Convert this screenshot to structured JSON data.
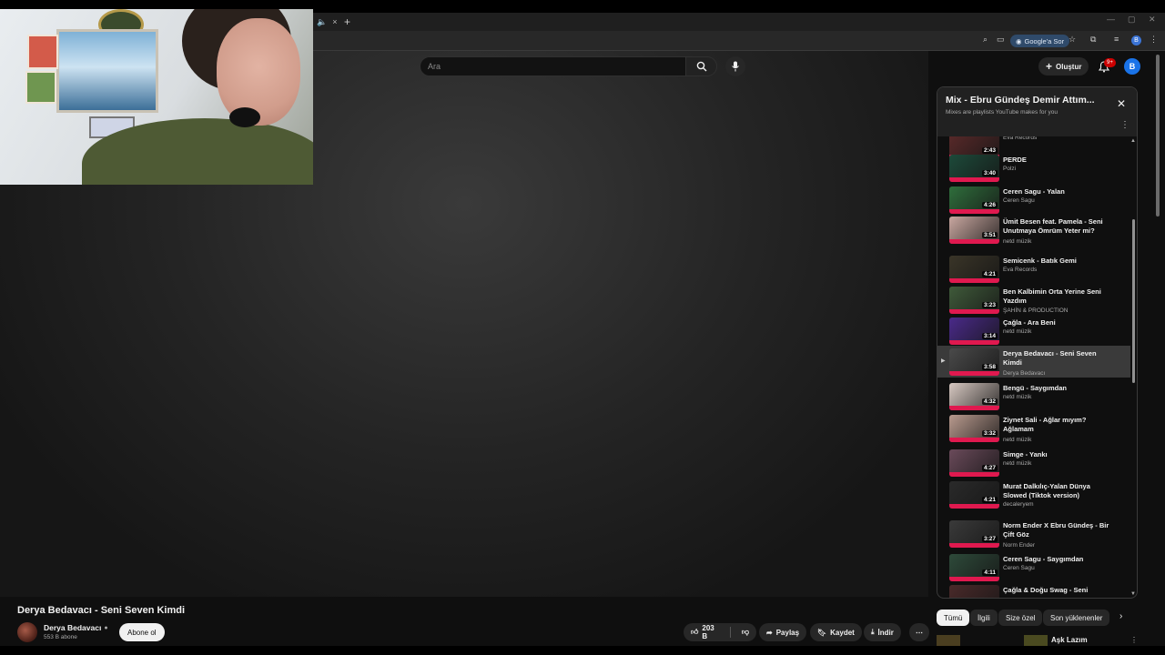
{
  "browser": {
    "tab_close": "×",
    "new_tab": "+",
    "google_sor": "Google'a Sor",
    "profile_initial": "B"
  },
  "header": {
    "search_placeholder": "Ara",
    "create_label": "Oluştur",
    "notif_badge": "9+",
    "avatar_initial": "B"
  },
  "video": {
    "title": "Derya Bedavacı - Seni Seven Kimdi",
    "channel": "Derya Bedavacı",
    "subscribers": "553 B abone",
    "subscribe_label": "Abone ol",
    "likes": "203 B",
    "share_label": "Paylaş",
    "save_label": "Kaydet",
    "download_label": "İndir"
  },
  "playlist": {
    "title": "Mix - Ebru Gündeş Demir Attım...",
    "subtitle": "Mixes are playlists YouTube makes for you",
    "items": [
      {
        "title": "",
        "channel": "Eva Records",
        "duration": "2:43",
        "color": "#5a2a2a"
      },
      {
        "title": "PERDE",
        "channel": "Polzi",
        "duration": "3:40",
        "color": "#1d4a3a"
      },
      {
        "title": "Ceren Sagu - Yalan",
        "channel": "Ceren Sagu",
        "duration": "4:26",
        "color": "#2f6e3c"
      },
      {
        "title": "Ümit Besen feat. Pamela - Seni Unutmaya Ömrüm Yeter mi?",
        "channel": "netd müzik",
        "duration": "3:51",
        "color": "#c9a7a0"
      },
      {
        "title": "Semicenk - Batık Gemi",
        "channel": "Eva Records",
        "duration": "4:21",
        "color": "#3a3528"
      },
      {
        "title": "Ben Kalbimin Orta Yerine Seni Yazdım",
        "channel": "ŞAHİN & PRODUCTION",
        "duration": "3:23",
        "color": "#3f5a3a"
      },
      {
        "title": "Çağla - Ara Beni",
        "channel": "netd müzik",
        "duration": "3:14",
        "color": "#4a2a8a"
      },
      {
        "title": "Derya Bedavacı - Seni Seven Kimdi",
        "channel": "Derya Bedavacı",
        "duration": "3:58",
        "color": "#4a4a4a",
        "active": true
      },
      {
        "title": "Bengü - Saygımdan",
        "channel": "netd müzik",
        "duration": "4:32",
        "color": "#d8c9c2"
      },
      {
        "title": "Ziynet Sali - Ağlar mıyım? Ağlamam",
        "channel": "netd müzik",
        "duration": "3:32",
        "color": "#b99a8e"
      },
      {
        "title": "Simge - Yankı",
        "channel": "netd müzik",
        "duration": "4:27",
        "color": "#6a4a5a"
      },
      {
        "title": "Murat Dalkılıç-Yalan Dünya Slowed (Tiktok version)",
        "channel": "decaleryem",
        "duration": "4:21",
        "color": "#2a2a2a"
      },
      {
        "title": "Norm Ender X Ebru Gündeş - Bir Çift Göz",
        "channel": "Norm Ender",
        "duration": "3:27",
        "color": "#3a3a3a"
      },
      {
        "title": "Ceren Sagu - Saygımdan",
        "channel": "Ceren Sagu",
        "duration": "4:11",
        "color": "#2e4a3a"
      },
      {
        "title": "Çağla & Doğu Swag - Seni",
        "channel": "",
        "duration": "",
        "color": "#4a2a2a"
      }
    ]
  },
  "chips": [
    "Tümü",
    "İlgili",
    "Size özel",
    "Son yüklenenler"
  ],
  "recommendation": {
    "title": "Aşk Lazım"
  }
}
